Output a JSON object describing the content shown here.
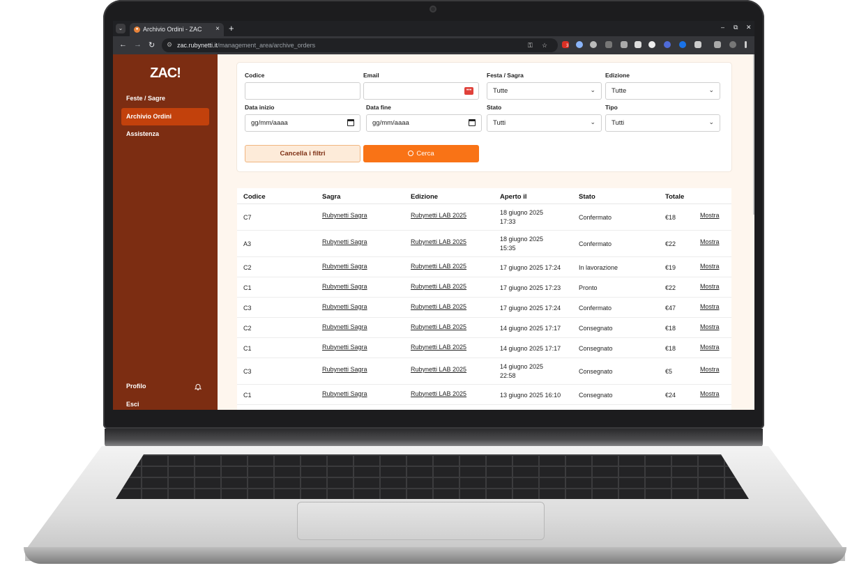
{
  "browser": {
    "tab_title": "Archivio Ordini - ZAC",
    "url_host": "zac.rubynetti.it",
    "url_path": "/management_area/archive_orders",
    "extension_badge": "3"
  },
  "sidebar": {
    "logo": "ZAC!",
    "items": [
      {
        "label": "Feste / Sagre"
      },
      {
        "label": "Archivio Ordini"
      },
      {
        "label": "Assistenza"
      }
    ],
    "profile_label": "Profilo",
    "logout_label": "Esci"
  },
  "filters": {
    "codice_label": "Codice",
    "email_label": "Email",
    "festa_label": "Festa / Sagra",
    "festa_value": "Tutte",
    "edizione_label": "Edizione",
    "edizione_value": "Tutte",
    "data_inizio_label": "Data inizio",
    "data_inizio_value": "gg/mm/aaaa",
    "data_fine_label": "Data fine",
    "data_fine_value": "gg/mm/aaaa",
    "stato_label": "Stato",
    "stato_value": "Tutti",
    "tipo_label": "Tipo",
    "tipo_value": "Tutti",
    "clear_button": "Cancella i filtri",
    "search_button": "Cerca"
  },
  "table": {
    "columns": [
      "Codice",
      "Sagra",
      "Edizione",
      "Aperto il",
      "Stato",
      "Totale"
    ],
    "action_label": "Mostra",
    "rows": [
      {
        "codice": "C7",
        "sagra": "Rubynetti Sagra",
        "edizione": "Rubynetti LAB 2025",
        "aperto_1": "18 giugno 2025",
        "aperto_2": "17:33",
        "stato": "Confermato",
        "totale": "€18"
      },
      {
        "codice": "A3",
        "sagra": "Rubynetti Sagra",
        "edizione": "Rubynetti LAB 2025",
        "aperto_1": "18 giugno 2025",
        "aperto_2": "15:35",
        "stato": "Confermato",
        "totale": "€22"
      },
      {
        "codice": "C2",
        "sagra": "Rubynetti Sagra",
        "edizione": "Rubynetti LAB 2025",
        "aperto_1": "17 giugno 2025 17:24",
        "aperto_2": "",
        "stato": "In lavorazione",
        "totale": "€19"
      },
      {
        "codice": "C1",
        "sagra": "Rubynetti Sagra",
        "edizione": "Rubynetti LAB 2025",
        "aperto_1": "17 giugno 2025 17:23",
        "aperto_2": "",
        "stato": "Pronto",
        "totale": "€22"
      },
      {
        "codice": "C3",
        "sagra": "Rubynetti Sagra",
        "edizione": "Rubynetti LAB 2025",
        "aperto_1": "17 giugno 2025 17:24",
        "aperto_2": "",
        "stato": "Confermato",
        "totale": "€47"
      },
      {
        "codice": "C2",
        "sagra": "Rubynetti Sagra",
        "edizione": "Rubynetti LAB 2025",
        "aperto_1": "14 giugno 2025 17:17",
        "aperto_2": "",
        "stato": "Consegnato",
        "totale": "€18"
      },
      {
        "codice": "C1",
        "sagra": "Rubynetti Sagra",
        "edizione": "Rubynetti LAB 2025",
        "aperto_1": "14 giugno 2025 17:17",
        "aperto_2": "",
        "stato": "Consegnato",
        "totale": "€18"
      },
      {
        "codice": "C3",
        "sagra": "Rubynetti Sagra",
        "edizione": "Rubynetti LAB 2025",
        "aperto_1": "14 giugno 2025",
        "aperto_2": "22:58",
        "stato": "Consegnato",
        "totale": "€5"
      },
      {
        "codice": "C1",
        "sagra": "Rubynetti Sagra",
        "edizione": "Rubynetti LAB 2025",
        "aperto_1": "13 giugno 2025 16:10",
        "aperto_2": "",
        "stato": "Consegnato",
        "totale": "€24"
      }
    ]
  }
}
